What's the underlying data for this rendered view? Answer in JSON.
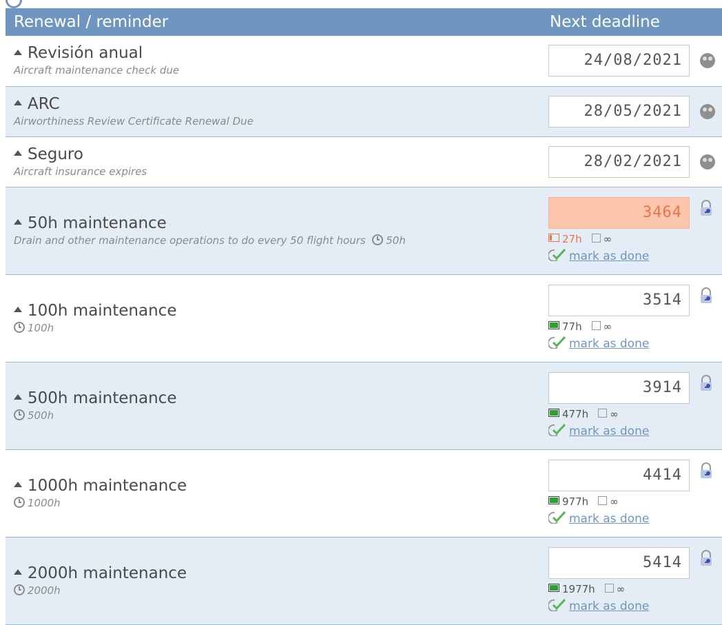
{
  "header": {
    "col_name": "Renewal / reminder",
    "col_deadline": "Next deadline"
  },
  "date_rows": [
    {
      "title": "Revisión anual",
      "desc": "Aircraft maintenance check due",
      "date": "24/08/2021"
    },
    {
      "title": "ARC",
      "desc": "Airworthiness Review Certificate Renewal Due",
      "date": "28/05/2021"
    },
    {
      "title": "Seguro",
      "desc": "Aircraft insurance expires",
      "date": "28/02/2021"
    }
  ],
  "hour_rows": [
    {
      "title": "50h maintenance",
      "desc": "Drain and other maintenance operations to do every 50 flight hours",
      "interval": "50h",
      "hours": "3464",
      "remaining": "27h",
      "remaining_fraction": 0.05,
      "status": "low",
      "calendar": "∞",
      "action": "mark as done"
    },
    {
      "title": "100h maintenance",
      "desc": "",
      "interval": "100h",
      "hours": "3514",
      "remaining": "77h",
      "remaining_fraction": 1,
      "status": "ok",
      "calendar": "∞",
      "action": "mark as done"
    },
    {
      "title": "500h maintenance",
      "desc": "",
      "interval": "500h",
      "hours": "3914",
      "remaining": "477h",
      "remaining_fraction": 1,
      "status": "ok",
      "calendar": "∞",
      "action": "mark as done"
    },
    {
      "title": "1000h maintenance",
      "desc": "",
      "interval": "1000h",
      "hours": "4414",
      "remaining": "977h",
      "remaining_fraction": 1,
      "status": "ok",
      "calendar": "∞",
      "action": "mark as done"
    },
    {
      "title": "2000h maintenance",
      "desc": "",
      "interval": "2000h",
      "hours": "5414",
      "remaining": "1977h",
      "remaining_fraction": 1,
      "status": "ok",
      "calendar": "∞",
      "action": "mark as done"
    }
  ],
  "colors": {
    "header_bg": "#6f95c1",
    "row_shade": "#e4ecf5",
    "alert_bg": "#fcc6ad",
    "alert_text": "#e8744e",
    "ok_bar": "#2ea02e",
    "link": "#6f95c1"
  },
  "icons": {
    "expand": "triangle-up-icon",
    "clock": "clock-icon",
    "people": "people-icon",
    "lock": "lock-key-icon",
    "battery": "battery-icon",
    "calendar": "calendar-icon",
    "check": "check-icon"
  }
}
